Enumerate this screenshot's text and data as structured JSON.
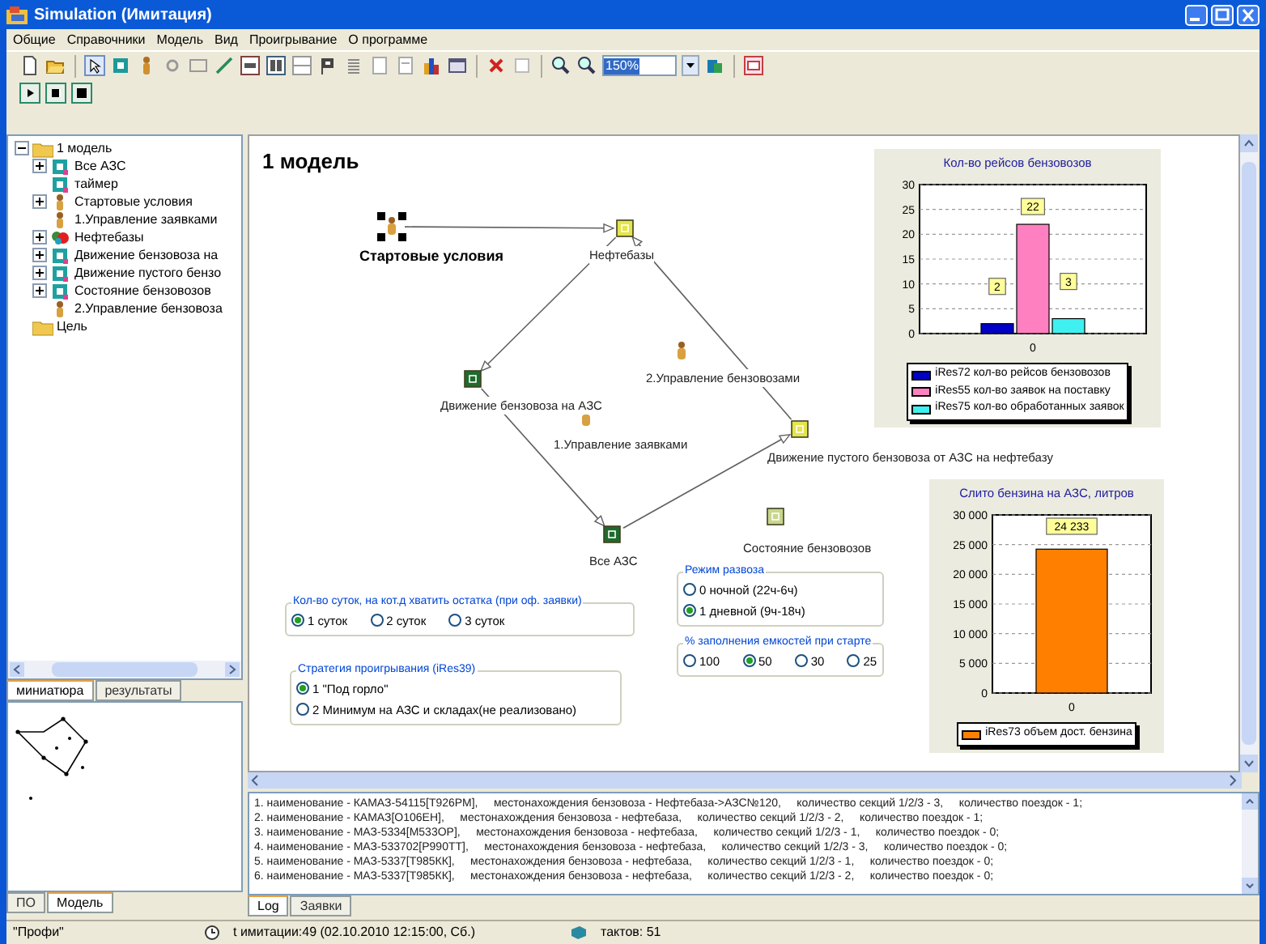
{
  "window": {
    "title": "Simulation (Имитация)"
  },
  "menu": [
    "Общие",
    "Справочники",
    "Модель",
    "Вид",
    "Проигрывание",
    "О программе"
  ],
  "toolbar": {
    "zoom_value": "150%"
  },
  "tree": [
    {
      "label": "1 модель",
      "kind": "folder",
      "expanded": true,
      "children": [
        {
          "label": "Все АЗС",
          "kind": "block",
          "expanded": false
        },
        {
          "label": "таймер",
          "kind": "block"
        },
        {
          "label": "Стартовые условия",
          "kind": "person",
          "expanded": false
        },
        {
          "label": "1.Управление заявками",
          "kind": "person"
        },
        {
          "label": "Нефтебазы",
          "kind": "base",
          "expanded": false
        },
        {
          "label": "Движение бензовоза на",
          "kind": "block",
          "expanded": false
        },
        {
          "label": "Движение пустого бензо",
          "kind": "block",
          "expanded": false
        },
        {
          "label": "Состояние бензовозов",
          "kind": "block",
          "expanded": false
        },
        {
          "label": "2.Управление бензовоза",
          "kind": "person"
        }
      ]
    },
    {
      "label": "Цель",
      "kind": "folder"
    }
  ],
  "left_tabs": [
    {
      "label": "миниатюра",
      "selected": true
    },
    {
      "label": "результаты",
      "selected": false
    }
  ],
  "bottom_left_tabs": [
    {
      "label": "ПО",
      "selected": false
    },
    {
      "label": "Модель",
      "selected": true
    }
  ],
  "canvas": {
    "title": "1 модель",
    "nodes": [
      {
        "label": "Стартовые условия",
        "kind": "person",
        "selected": true
      },
      {
        "label": "Нефтебазы",
        "kind": "block",
        "color": "#e4e44c",
        "selected": false
      },
      {
        "label": "2.Управление бензовозами",
        "kind": "person",
        "selected": false
      },
      {
        "label": "Движение бензовоза на АЗС",
        "kind": "block",
        "color": "#1e6b2e",
        "selected": false
      },
      {
        "label": "1.Управление заявками",
        "kind": "person",
        "selected": false
      },
      {
        "label": "Движение пустого бензовоза от АЗС на нефтебазу",
        "kind": "block",
        "color": "#e4e44c",
        "selected": false
      },
      {
        "label": "Состояние бензовозов",
        "kind": "block",
        "color": "#c9d68c",
        "selected": false
      },
      {
        "label": "Все АЗС",
        "kind": "block",
        "color": "#1e6b2e",
        "selected": false
      }
    ],
    "charts": [
      {
        "chart_data": {
          "type": "bar",
          "title": "Кол-во рейсов бензовозов",
          "categories": [
            "0"
          ],
          "series": [
            {
              "name": "iRes72 кол-во рейсов бензовозов",
              "color": "#0000c8",
              "values": [
                2
              ]
            },
            {
              "name": "iRes55 кол-во заявок на поставку",
              "color": "#ff80c0",
              "values": [
                22
              ]
            },
            {
              "name": "iRes75 кол-во обработанных заявок",
              "color": "#40f0f0",
              "values": [
                3
              ]
            }
          ],
          "ylim": [
            0,
            30
          ],
          "yticks": [
            {
              "value": 0,
              "label": "0"
            },
            {
              "value": 5,
              "label": "5"
            },
            {
              "value": 10,
              "label": "10"
            },
            {
              "value": 15,
              "label": "15"
            },
            {
              "value": 20,
              "label": "20"
            },
            {
              "value": 25,
              "label": "25"
            },
            {
              "value": 30,
              "label": "30"
            }
          ],
          "data_labels": true,
          "grid": true,
          "legend": "bottom"
        }
      },
      {
        "chart_data": {
          "type": "bar",
          "title": "Слито бензина на АЗС, литров",
          "categories": [
            "0"
          ],
          "series": [
            {
              "name": "iRes73 объем дост. бензина",
              "color": "#ff8000",
              "values": [
                24233
              ]
            }
          ],
          "ylim": [
            0,
            30000
          ],
          "yticks": [
            {
              "value": 0,
              "label": "0"
            },
            {
              "value": 5000,
              "label": "5 000"
            },
            {
              "value": 10000,
              "label": "10 000"
            },
            {
              "value": 15000,
              "label": "15 000"
            },
            {
              "value": 20000,
              "label": "20 000"
            },
            {
              "value": 25000,
              "label": "25 000"
            },
            {
              "value": 30000,
              "label": "30 000"
            }
          ],
          "value_labels": [
            "24 233"
          ],
          "grid": true,
          "legend": "bottom"
        }
      }
    ],
    "radio_groups": [
      {
        "title": "Кол-во суток, на кот.д хватить остатка (при оф. заявки)",
        "options": [
          {
            "label": "1 суток",
            "selected": true
          },
          {
            "label": "2 суток",
            "selected": false
          },
          {
            "label": "3 суток",
            "selected": false
          }
        ]
      },
      {
        "title": "Стратегия проигрывания (iRes39)",
        "options": [
          {
            "label": "1 \"Под горло\"",
            "selected": true
          },
          {
            "label": "2 Минимум на АЗС и складах(не реализовано)",
            "selected": false
          }
        ]
      },
      {
        "title": "Режим развоза",
        "options": [
          {
            "label": "0 ночной (22ч-6ч)",
            "selected": false
          },
          {
            "label": "1 дневной (9ч-18ч)",
            "selected": true
          }
        ]
      },
      {
        "title": "% заполнения емкостей при старте",
        "options": [
          {
            "label": "100",
            "selected": false
          },
          {
            "label": "50",
            "selected": true
          },
          {
            "label": "30",
            "selected": false
          },
          {
            "label": "25",
            "selected": false
          }
        ]
      }
    ]
  },
  "log": {
    "lines": [
      "1. наименование - КАМАЗ-54115[Т926РМ],     местонахождения бензовоза - Нефтебаза->АЗС№120,     количество секций 1/2/3 - 3,     количество поездок - 1;",
      "2. наименование - КАМАЗ[О106ЕН],     местонахождения бензовоза - нефтебаза,     количество секций 1/2/3 - 2,     количество поездок - 1;",
      "3. наименование - МАЗ-5334[М533ОР],     местонахождения бензовоза - нефтебаза,     количество секций 1/2/3 - 1,     количество поездок - 0;",
      "4. наименование - МАЗ-533702[Р990ТТ],     местонахождения бензовоза - нефтебаза,     количество секций 1/2/3 - 3,     количество поездок - 0;",
      "5. наименование - МАЗ-5337[Т985КК],     местонахождения бензовоза - нефтебаза,     количество секций 1/2/3 - 1,     количество поездок - 0;",
      "6. наименование - МАЗ-5337[Т985КК],     местонахождения бензовоза - нефтебаза,     количество секций 1/2/3 - 2,     количество поездок - 0;"
    ],
    "tabs": [
      {
        "label": "Log",
        "selected": true
      },
      {
        "label": "Заявки",
        "selected": false
      }
    ]
  },
  "status_bar": {
    "mode": "\"Профи\"",
    "sim_time": "t имитации:49 (02.10.2010 12:15:00, Сб.)",
    "ticks": "тактов: 51"
  }
}
